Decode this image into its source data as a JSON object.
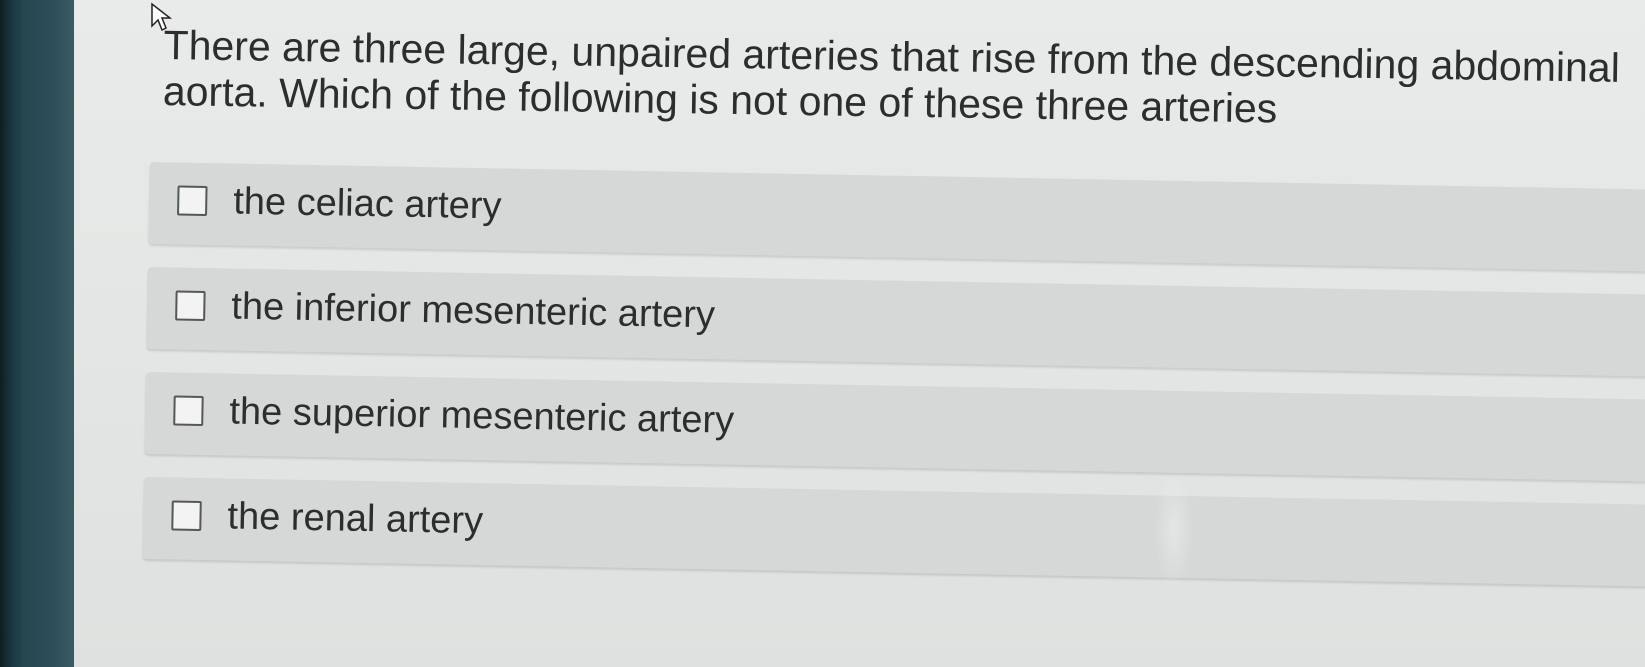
{
  "question": {
    "text": "There are three large, unpaired arteries that rise from the descending abdominal aorta. Which of the following is not one of these three arteries"
  },
  "options": [
    {
      "label": "the celiac artery",
      "checked": false
    },
    {
      "label": "the inferior mesenteric artery",
      "checked": false
    },
    {
      "label": "the superior mesenteric artery",
      "checked": false
    },
    {
      "label": "the renal artery",
      "checked": false
    }
  ],
  "colors": {
    "page_background": "#e6e8e7",
    "option_background": "#d6d8d7",
    "text": "#2b2d2f",
    "checkbox_border": "#55585a"
  }
}
